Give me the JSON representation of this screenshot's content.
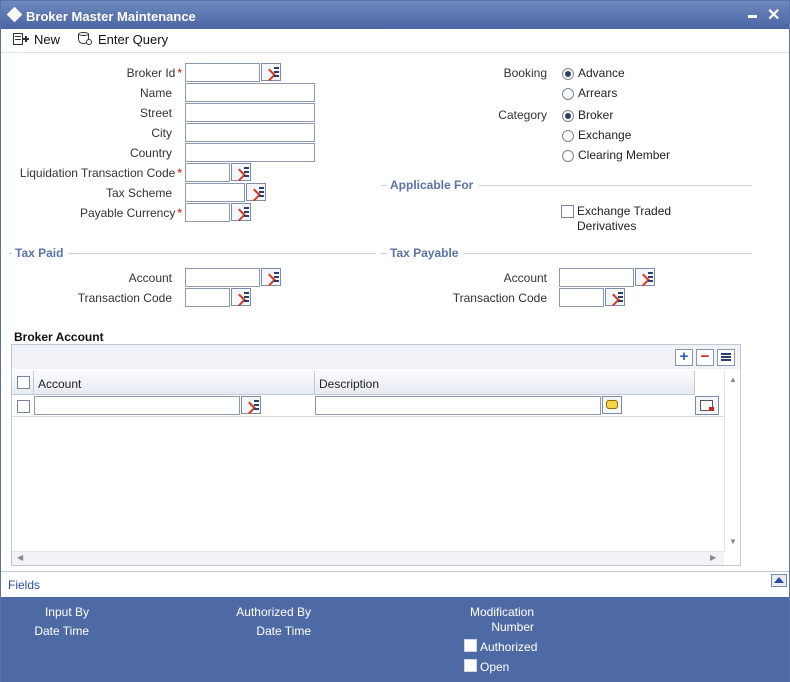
{
  "window": {
    "title": "Broker Master Maintenance"
  },
  "toolbar": {
    "new_label": "New",
    "enter_query_label": "Enter Query"
  },
  "form": {
    "broker_id": "Broker Id",
    "name": "Name",
    "street": "Street",
    "city": "City",
    "country": "Country",
    "liquidation_txn_code": "Liquidation Transaction Code",
    "tax_scheme": "Tax Scheme",
    "payable_currency": "Payable Currency",
    "required_mark": "*"
  },
  "booking": {
    "label": "Booking",
    "options": [
      "Advance",
      "Arrears"
    ],
    "selected": "Advance"
  },
  "category": {
    "label": "Category",
    "options": [
      "Broker",
      "Exchange",
      "Clearing Member"
    ],
    "selected": "Broker"
  },
  "applicable_for": {
    "title": "Applicable For",
    "etd_line1": "Exchange Traded",
    "etd_line2": "Derivatives"
  },
  "tax_paid": {
    "title": "Tax Paid",
    "account": "Account",
    "transaction_code": "Transaction Code"
  },
  "tax_payable": {
    "title": "Tax Payable",
    "account": "Account",
    "transaction_code": "Transaction Code"
  },
  "broker_account": {
    "title": "Broker Account",
    "columns": [
      "Account",
      "Description"
    ]
  },
  "fields_link": "Fields",
  "footer": {
    "input_by": "Input By",
    "date_time_1": "Date Time",
    "authorized_by": "Authorized By",
    "date_time_2": "Date Time",
    "modification": "Modification",
    "number": "Number",
    "authorized": "Authorized",
    "open": "Open"
  }
}
